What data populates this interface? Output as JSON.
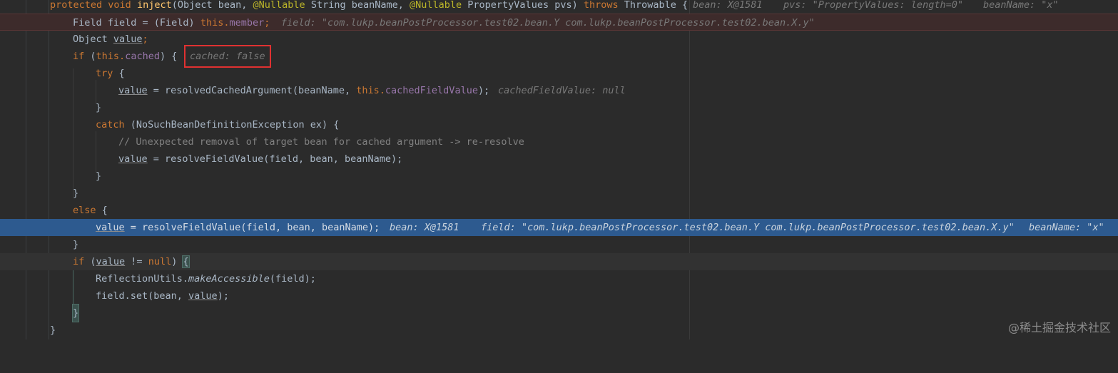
{
  "code": {
    "method_signature": {
      "kw_protected": "protected",
      "kw_void": "void",
      "method_name": "inject",
      "params_part1": "(Object bean, ",
      "ann1": "@Nullable",
      "params_part2": " String beanName, ",
      "ann2": "@Nullable",
      "params_part3": " PropertyValues pvs) ",
      "kw_throws": "throws",
      "throwable": " Throwable {",
      "hint_bean": "bean: X@1581",
      "hint_pvs": "pvs: \"PropertyValues: length=0\"",
      "hint_beanname": "beanName: \"x\""
    },
    "line_field": {
      "part1": "Field field = (Field) ",
      "kw_this": "this",
      "dot": ".",
      "member": "member",
      "semi": ";",
      "hint": "field: \"com.lukp.beanPostProcessor.test02.bean.Y com.lukp.beanPostProcessor.test02.bean.X.y\""
    },
    "line_object": {
      "type": "Object ",
      "var": "value",
      "semi": ";"
    },
    "line_if_cached": {
      "kw_if": "if",
      "open": " (",
      "kw_this": "this",
      "dot": ".",
      "cached": "cached",
      "close": ") {",
      "hint": "cached: false"
    },
    "line_try": {
      "kw": "try",
      "rest": " {"
    },
    "line_resolved_cached": {
      "var": "value",
      "mid": " = resolvedCachedArgument(beanName, ",
      "kw_this": "this",
      "dot": ".",
      "field": "cachedFieldValue",
      "end": ");",
      "hint": "cachedFieldValue: null"
    },
    "close_brace": "}",
    "line_catch": {
      "kw": "catch",
      "rest": " (NoSuchBeanDefinitionException ex) {"
    },
    "line_comment": "// Unexpected removal of target bean for cached argument -> re-resolve",
    "line_resolve1": {
      "var": "value",
      "rest": " = resolveFieldValue(field, bean, beanName);"
    },
    "line_else": {
      "kw": "else",
      "rest": " {"
    },
    "line_resolve_exec": {
      "var": "value",
      "rest": " = resolveFieldValue(field, bean, beanName);",
      "hint_bean": "bean: X@1581",
      "hint_field": "field: \"com.lukp.beanPostProcessor.test02.bean.Y com.lukp.beanPostProcessor.test02.bean.X.y\"",
      "hint_beanname": "beanName: \"x\""
    },
    "line_if_null": {
      "kw_if": "if",
      "open": " (",
      "var": "value",
      "op": " != ",
      "kw_null": "null",
      "close": ") ",
      "brace": "{"
    },
    "line_make_accessible": {
      "cls": "ReflectionUtils.",
      "method": "makeAccessible",
      "rest": "(field);"
    },
    "line_field_set": {
      "part1": "field.set(bean, ",
      "var": "value",
      "end": ");"
    },
    "final_brace": "}"
  },
  "watermark": "@稀土掘金技术社区"
}
